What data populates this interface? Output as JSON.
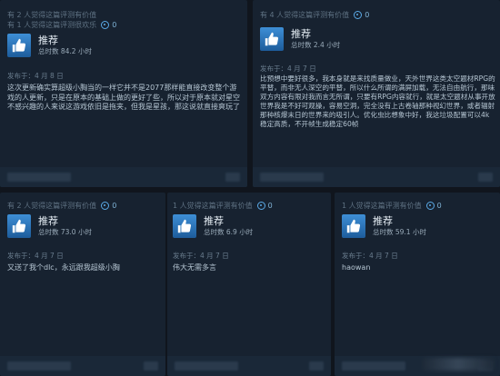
{
  "reviews": [
    {
      "helpful_line": "有 2 人觉得这篇评测有价值",
      "funny_line": "有 1 人觉得这篇评测很欢乐",
      "award_count": "0",
      "verdict": "推荐",
      "hours": "总时数 84.2 小时",
      "posted": "发布于：4 月 8 日",
      "text": "这次更新确实算超级小胸当的一样它并不是2077那样能直接改变整个游戏的人更新，只是在原本的基础上做的更好了些，所以对于原本就对星空不感兴趣的人来说这游戏依旧是拖夹，但我是星孩，那这说就直接爽玩了"
    },
    {
      "helpful_line": "有 4 人觉得这篇评测有价值",
      "award_count": "0",
      "verdict": "推荐",
      "hours": "总时数 2.4 小时",
      "posted": "发布于：4 月 7 日",
      "text": "比预想中要好很多，我本身就是来找质量做业，天外世界这类太空题材RPG的平替，而非无人深空的平替，所以什么所谓的满屏加载，无法自由航行，那味双方内容有限对我而言无所谓，只要有RPG内容就行，就是太空题材从事开放世界我是不好可观操，容易空洞，完全没有上古卷轴那种视幻世界，或者辐射那种核爆末日的世界来的吸引人。优化虫比想象中好，我这垃圾配置可以4k 稳定高质，不开帧生成稳定60帧"
    },
    {
      "helpful_line": "有 2 人觉得这篇评测有价值",
      "award_count": "0",
      "verdict": "推荐",
      "hours": "总时数 73.0 小时",
      "posted": "发布于：4 月 7 日",
      "text": "又送了我个dlc，永远跟我超级小胸"
    },
    {
      "helpful_line": "1 人觉得这篇评测有价值",
      "award_count": "0",
      "verdict": "推荐",
      "hours": "总时数 6.9 小时",
      "posted": "发布于：4 月 7 日",
      "text": "伟大无需多言"
    },
    {
      "helpful_line": "1 人觉得这篇评测有价值",
      "award_count": "0",
      "verdict": "推荐",
      "hours": "总时数 59.1 小时",
      "posted": "发布于：4 月 7 日",
      "text": "haowan"
    }
  ]
}
